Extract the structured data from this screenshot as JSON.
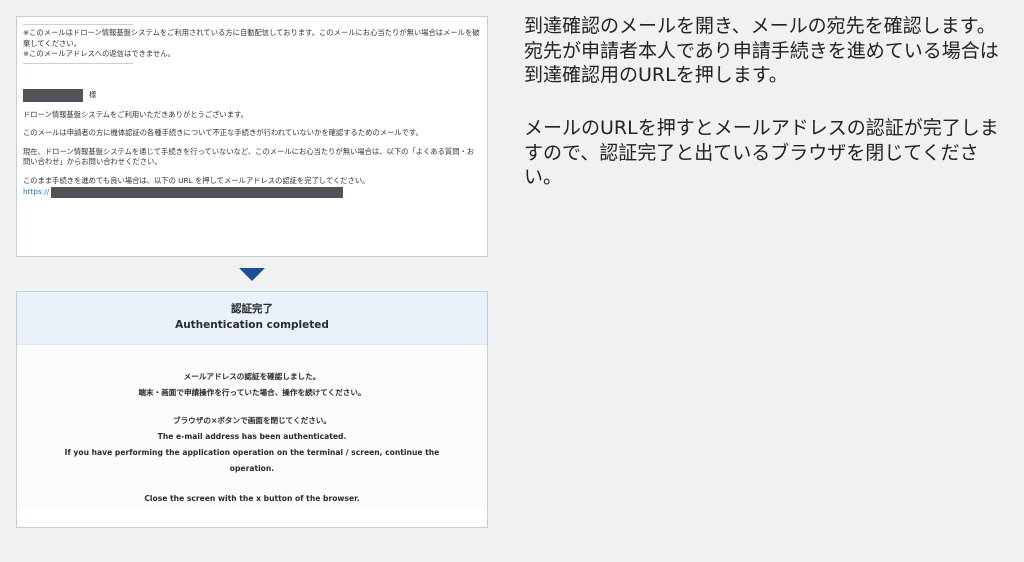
{
  "email": {
    "notice_1": "※このメールはドローン情報基盤システムをご利用されている方に自動配信しております。このメールにお心当たりが無い場合はメールを破棄してください。",
    "notice_2": "※このメールアドレスへの返信はできません。",
    "honorific": "様",
    "greeting": "ドローン情報基盤システムをご利用いただきありがとうございます。",
    "purpose": "このメールは申請者の方に機体認証の各種手続きについて不正な手続きが行われていないかを確認するためのメールです。",
    "contact": "現在、ドローン情報基盤システムを通じて手続きを行っていないなど、このメールにお心当たりが無い場合は、以下の「よくある質問・お問い合わせ」からお問い合わせください。",
    "continue": "このまま手続きを進めても良い場合は、以下の URL を押してメールアドレスの認証を完了してください。",
    "url_prefix": "https://"
  },
  "auth": {
    "title_ja": "認証完了",
    "title_en": "Authentication completed",
    "line1": "メールアドレスの認証を確認しました。",
    "line2": "端末・画面で申請操作を行っていた場合、操作を続けてください。",
    "line3": "ブラウザの×ボタンで画面を閉じてください。",
    "line4": "The e-mail address has been authenticated.",
    "line5": "If you have performing the application operation on the terminal / screen, continue the",
    "line6": "operation.",
    "line7": "Close the screen with the x button of the browser."
  },
  "instructions": {
    "step1": "到達確認のメールを開き、メールの宛先を確認します。宛先が申請者本人であり申請手続きを進めている場合は到達確認用のURLを押します。",
    "step2": "メールのURLを押すとメールアドレスの認証が完了しますので、認証完了と出ているブラウザを閉じてください。"
  },
  "colors": {
    "arrow": "#1b4e94",
    "header_bg": "#e9f1fb",
    "link": "#2a6db3"
  }
}
